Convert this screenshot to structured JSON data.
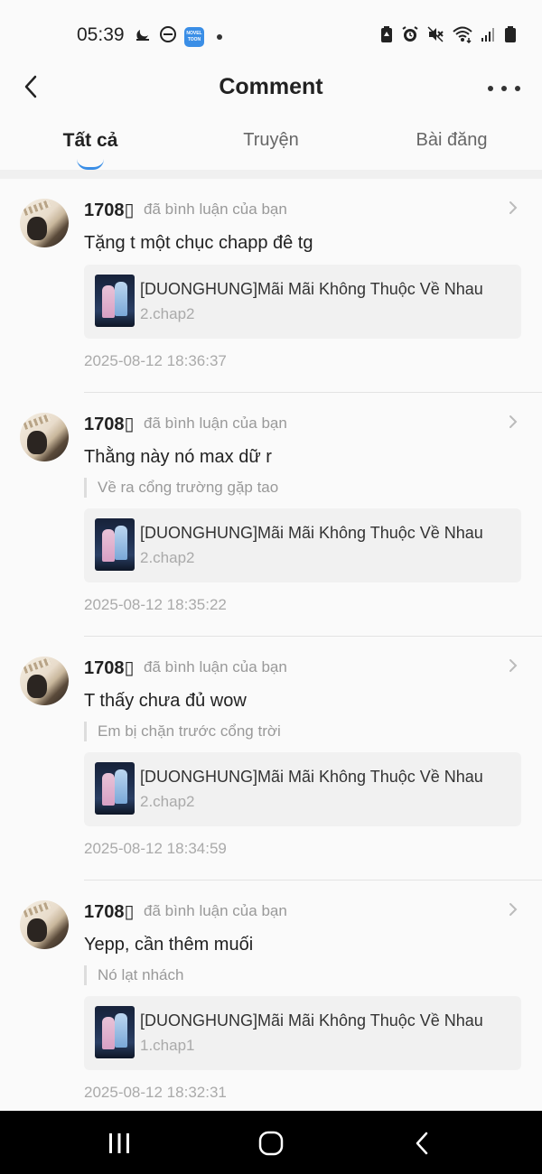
{
  "status_bar": {
    "time": "05:39",
    "app_badge_line1": "NOVEL",
    "app_badge_line2": "TOON",
    "left_icons": [
      "moon-icon",
      "dnd-icon",
      "novel-toon-app-icon",
      "dot-icon"
    ],
    "right_icons": [
      "battery-saver-icon",
      "alarm-icon",
      "mute-icon",
      "wifi-icon",
      "signal-icon",
      "battery-icon"
    ]
  },
  "header": {
    "title": "Comment",
    "back_icon": "back-arrow-icon",
    "more_icon": "more-dots-icon"
  },
  "tabs": [
    {
      "label": "Tất cả",
      "active": true
    },
    {
      "label": "Truyện",
      "active": false
    },
    {
      "label": "Bài đăng",
      "active": false
    }
  ],
  "accent_color": "#3a8ee6",
  "comments": [
    {
      "user": "1708▯",
      "action": "đã bình luận của bạn",
      "text": "Tặng t một chục chapp đê tg",
      "quote": "",
      "story_title": "[DUONGHUNG]Mãi Mãi Không Thuộc Về Nhau",
      "chapter": "2.chap2",
      "time": "2025-08-12 18:36:37"
    },
    {
      "user": "1708▯",
      "action": "đã bình luận của bạn",
      "text": "Thằng này nó max dữ r",
      "quote": "Về ra cổng trường gặp tao",
      "story_title": "[DUONGHUNG]Mãi Mãi Không Thuộc Về Nhau",
      "chapter": "2.chap2",
      "time": "2025-08-12 18:35:22"
    },
    {
      "user": "1708▯",
      "action": "đã bình luận của bạn",
      "text": "T thấy chưa đủ wow",
      "quote": "Em bị chặn trước cổng trời",
      "story_title": "[DUONGHUNG]Mãi Mãi Không Thuộc Về Nhau",
      "chapter": "2.chap2",
      "time": "2025-08-12 18:34:59"
    },
    {
      "user": "1708▯",
      "action": "đã bình luận của bạn",
      "text": "Yepp, cần thêm muối",
      "quote": "Nó lạt nhách",
      "story_title": "[DUONGHUNG]Mãi Mãi Không Thuộc Về Nhau",
      "chapter": "1.chap1",
      "time": "2025-08-12 18:32:31"
    }
  ],
  "nav_bar": {
    "icons": [
      "recent-apps-icon",
      "home-icon",
      "back-icon"
    ]
  }
}
